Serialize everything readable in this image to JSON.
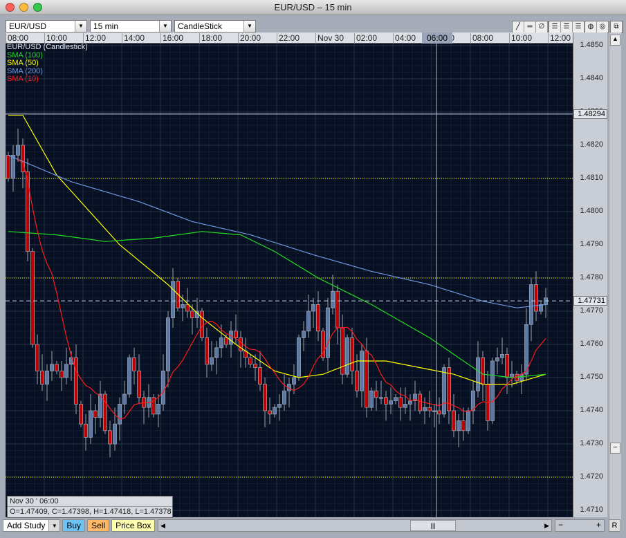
{
  "window": {
    "title": "EUR/USD – 15 min"
  },
  "toolbar": {
    "symbol": "EUR/USD",
    "interval": "15 min",
    "chart_type": "CandleStick",
    "tools": [
      "line-tool-icon",
      "horizontal-line-tool-icon",
      "no-tool-icon",
      "grid-dense-icon",
      "grid-medium-icon",
      "grid-light-icon",
      "theme-dark-icon",
      "theme-pattern-icon",
      "detach-window-icon"
    ]
  },
  "legend": {
    "main": "EUR/USD (Candlestick)",
    "items": [
      {
        "label": "SMA (100)",
        "color": "#22e022"
      },
      {
        "label": "SMA (50)",
        "color": "#ffff00"
      },
      {
        "label": "SMA (200)",
        "color": "#6f96e0"
      },
      {
        "label": "SMA (10)",
        "color": "#ff1a1a"
      }
    ]
  },
  "crosshair": {
    "time": "06:00",
    "candle_index": 88
  },
  "info_box": {
    "date": "Nov 30 ' 06:00",
    "ohlc": "O=1.47409, C=1.47398, H=1.47418, L=1.47378"
  },
  "bottom": {
    "add_study": "Add Study",
    "buy": "Buy",
    "sell": "Sell",
    "price_box": "Price Box",
    "reset": "R"
  },
  "chart_data": {
    "type": "candlestick",
    "title": "EUR/USD (Candlestick)",
    "x_ticks": [
      "08:00",
      "10:00",
      "12:00",
      "14:00",
      "16:00",
      "18:00",
      "20:00",
      "22:00",
      "Nov 30",
      "02:00",
      "04:00",
      "06:00",
      "08:00",
      "10:00",
      "12:00"
    ],
    "y_ticks": [
      "1.4850",
      "1.4840",
      "1.4830",
      "1.4820",
      "1.4810",
      "1.4800",
      "1.4790",
      "1.4780",
      "1.4770",
      "1.4760",
      "1.4750",
      "1.4740",
      "1.4730",
      "1.4720",
      "1.4710"
    ],
    "ylim": [
      1.4705,
      1.4851
    ],
    "candles_per_tick": 8,
    "closes": [
      1.481,
      1.4817,
      1.482,
      1.4812,
      1.4788,
      1.476,
      1.4752,
      1.4748,
      1.4752,
      1.4754,
      1.4752,
      1.475,
      1.4754,
      1.4756,
      1.4742,
      1.4736,
      1.4732,
      1.474,
      1.4738,
      1.4745,
      1.4734,
      1.473,
      1.4736,
      1.4742,
      1.4745,
      1.4756,
      1.4752,
      1.4744,
      1.4741,
      1.4744,
      1.4739,
      1.4742,
      1.4752,
      1.4768,
      1.4779,
      1.4771,
      1.4772,
      1.477,
      1.4768,
      1.477,
      1.4762,
      1.4754,
      1.4756,
      1.4759,
      1.4762,
      1.476,
      1.4764,
      1.4762,
      1.4758,
      1.4756,
      1.4754,
      1.4753,
      1.4748,
      1.474,
      1.4739,
      1.4741,
      1.4742,
      1.4746,
      1.4748,
      1.475,
      1.4762,
      1.4764,
      1.477,
      1.4772,
      1.4764,
      1.4756,
      1.4771,
      1.4776,
      1.4765,
      1.4751,
      1.4762,
      1.4752,
      1.4746,
      1.4758,
      1.4741,
      1.4746,
      1.4744,
      1.4744,
      1.4742,
      1.4743,
      1.4744,
      1.4741,
      1.4742,
      1.4743,
      1.4745,
      1.474,
      1.4741,
      1.474,
      1.474,
      1.4739,
      1.4753,
      1.474,
      1.4734,
      1.4737,
      1.4734,
      1.474,
      1.4746,
      1.4756,
      1.4748,
      1.4737,
      1.4755,
      1.4756,
      1.4757,
      1.475,
      1.4751,
      1.4749,
      1.4751,
      1.4766,
      1.4778,
      1.477,
      1.4772,
      1.4774
    ],
    "sma": [
      {
        "name": "SMA (50)",
        "color": "#ffff00",
        "points": [
          [
            0,
            1.4829
          ],
          [
            3,
            1.4829
          ],
          [
            10,
            1.4811
          ],
          [
            23,
            1.479
          ],
          [
            33,
            1.4778
          ],
          [
            40,
            1.4768
          ],
          [
            47,
            1.476
          ],
          [
            55,
            1.4752
          ],
          [
            60,
            1.475
          ],
          [
            65,
            1.4751
          ],
          [
            72,
            1.4755
          ],
          [
            78,
            1.4755
          ],
          [
            85,
            1.4753
          ],
          [
            92,
            1.4751
          ],
          [
            98,
            1.4748
          ],
          [
            104,
            1.4748
          ],
          [
            111,
            1.4751
          ]
        ]
      },
      {
        "name": "SMA (100)",
        "color": "#22e022",
        "points": [
          [
            0,
            1.4794
          ],
          [
            10,
            1.4793
          ],
          [
            20,
            1.4791
          ],
          [
            30,
            1.4792
          ],
          [
            40,
            1.4794
          ],
          [
            48,
            1.4793
          ],
          [
            55,
            1.4788
          ],
          [
            64,
            1.478
          ],
          [
            75,
            1.4772
          ],
          [
            87,
            1.4762
          ],
          [
            98,
            1.4751
          ],
          [
            104,
            1.475
          ],
          [
            111,
            1.4751
          ]
        ]
      },
      {
        "name": "SMA (200)",
        "color": "#6f96e0",
        "points": [
          [
            0,
            1.4817
          ],
          [
            13,
            1.4809
          ],
          [
            27,
            1.4803
          ],
          [
            38,
            1.4797
          ],
          [
            50,
            1.4793
          ],
          [
            63,
            1.4787
          ],
          [
            75,
            1.4782
          ],
          [
            87,
            1.4778
          ],
          [
            98,
            1.4773
          ],
          [
            105,
            1.4771
          ],
          [
            111,
            1.4772
          ]
        ]
      }
    ],
    "sma10_color": "#ff1a1a",
    "reference_lines": [
      {
        "label": "1.48294",
        "value": 1.48294,
        "style": "solid"
      },
      {
        "label": "1.47731",
        "value": 1.47731,
        "style": "dashed"
      }
    ],
    "alert_lines": [
      1.481,
      1.478,
      1.472
    ]
  }
}
